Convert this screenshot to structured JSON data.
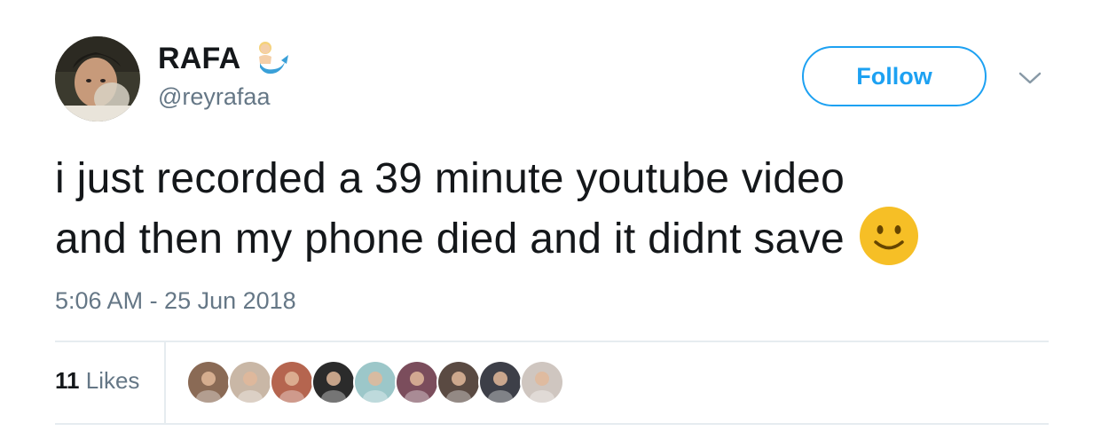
{
  "user": {
    "display_name": "RAFA",
    "handle": "@reyrafaa",
    "name_emoji": "merman-emoji"
  },
  "follow_button": {
    "label": "Follow",
    "color": "#1da1f2"
  },
  "menu": {
    "icon": "chevron-down-icon"
  },
  "tweet": {
    "line1": "i just recorded a 39 minute youtube video",
    "line2": "and then my phone died and it didnt save",
    "emoji": "slightly-smiling-face-emoji",
    "timestamp": "5:06 AM - 25 Jun 2018"
  },
  "stats": {
    "likes_count": "11",
    "likes_label": "Likes",
    "liker_avatars": [
      {
        "name": "liker-avatar-1",
        "color": "#8a6a55"
      },
      {
        "name": "liker-avatar-2",
        "color": "#c9b7a6"
      },
      {
        "name": "liker-avatar-3",
        "color": "#b5654f"
      },
      {
        "name": "liker-avatar-4",
        "color": "#2b2b2b"
      },
      {
        "name": "liker-avatar-5",
        "color": "#9cc7c9"
      },
      {
        "name": "liker-avatar-6",
        "color": "#7b4d5c"
      },
      {
        "name": "liker-avatar-7",
        "color": "#5a4a42"
      },
      {
        "name": "liker-avatar-8",
        "color": "#3d3f48"
      },
      {
        "name": "liker-avatar-9",
        "color": "#cfc6c0"
      }
    ]
  },
  "colors": {
    "text_primary": "#14171a",
    "text_secondary": "#657786",
    "divider": "#e6ecf0",
    "accent": "#1da1f2",
    "emoji_yellow": "#f6bf26"
  }
}
